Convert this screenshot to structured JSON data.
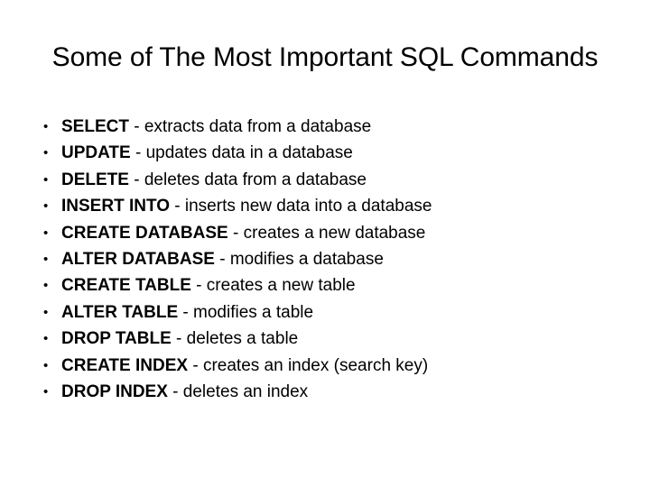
{
  "slide": {
    "title": "Some of The Most Important SQL Commands",
    "background_color": "#FFFFFF",
    "text_color": "#000000",
    "bullet_glyph": "•",
    "separator": " - ",
    "items": [
      {
        "command": "SELECT",
        "separator": " - ",
        "description": "extracts data from a database"
      },
      {
        "command": "UPDATE",
        "separator": " - ",
        "description": "updates data in a database"
      },
      {
        "command": "DELETE",
        "separator": " - ",
        "description": "deletes data from a database"
      },
      {
        "command": "INSERT INTO",
        "separator": " - ",
        "description": "inserts new data into a database"
      },
      {
        "command": "CREATE DATABASE",
        "separator": " - ",
        "description": "creates a new database"
      },
      {
        "command": "ALTER DATABASE",
        "separator": " - ",
        "description": "modifies a database"
      },
      {
        "command": "CREATE TABLE",
        "separator": " - ",
        "description": "creates a new table"
      },
      {
        "command": "ALTER TABLE",
        "separator": " - ",
        "description": "modifies a table"
      },
      {
        "command": "DROP TABLE",
        "separator": " - ",
        "description": "deletes a table"
      },
      {
        "command": "CREATE INDEX",
        "separator": " - ",
        "description": "creates an index (search key)"
      },
      {
        "command": "DROP INDEX",
        "separator": " - ",
        "description": "deletes an index"
      }
    ]
  }
}
